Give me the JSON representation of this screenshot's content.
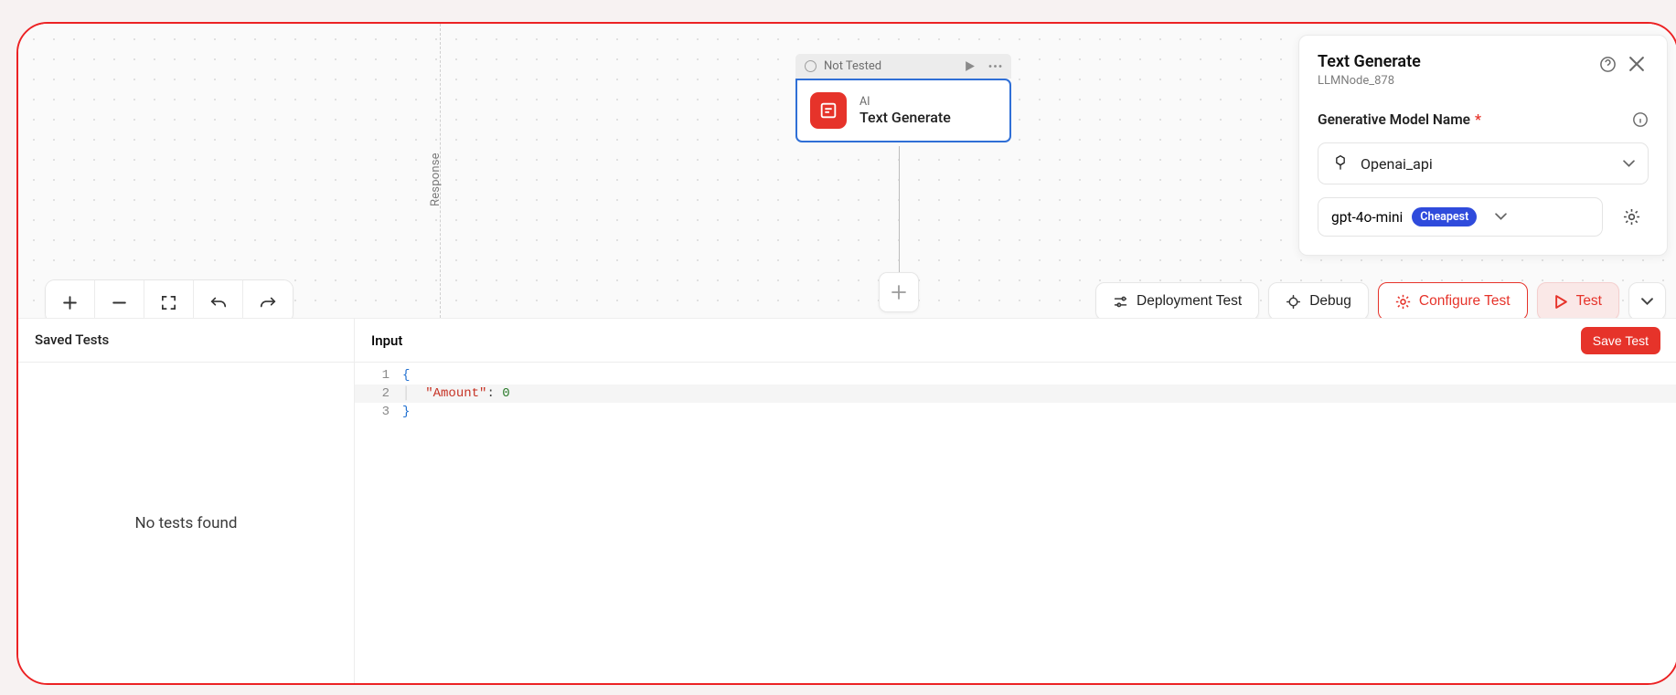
{
  "canvas": {
    "divider_label": "Response",
    "node": {
      "status": "Not Tested",
      "category": "AI",
      "title": "Text Generate"
    }
  },
  "toolbar_right": {
    "deployment_test": "Deployment Test",
    "debug": "Debug",
    "configure_test": "Configure Test",
    "test": "Test"
  },
  "bottom": {
    "saved_tests_header": "Saved Tests",
    "no_tests": "No tests found",
    "input_header": "Input",
    "save_test": "Save Test",
    "code": {
      "lines": [
        {
          "n": "1",
          "open_brace": "{"
        },
        {
          "n": "2",
          "key": "\"Amount\"",
          "colon": ": ",
          "value": "0"
        },
        {
          "n": "3",
          "close_brace": "}"
        }
      ]
    }
  },
  "side_panel": {
    "title": "Text Generate",
    "subtitle": "LLMNode_878",
    "section_label": "Generative Model Name",
    "provider": "Openai_api",
    "model": "gpt-4o-mini",
    "badge": "Cheapest"
  }
}
